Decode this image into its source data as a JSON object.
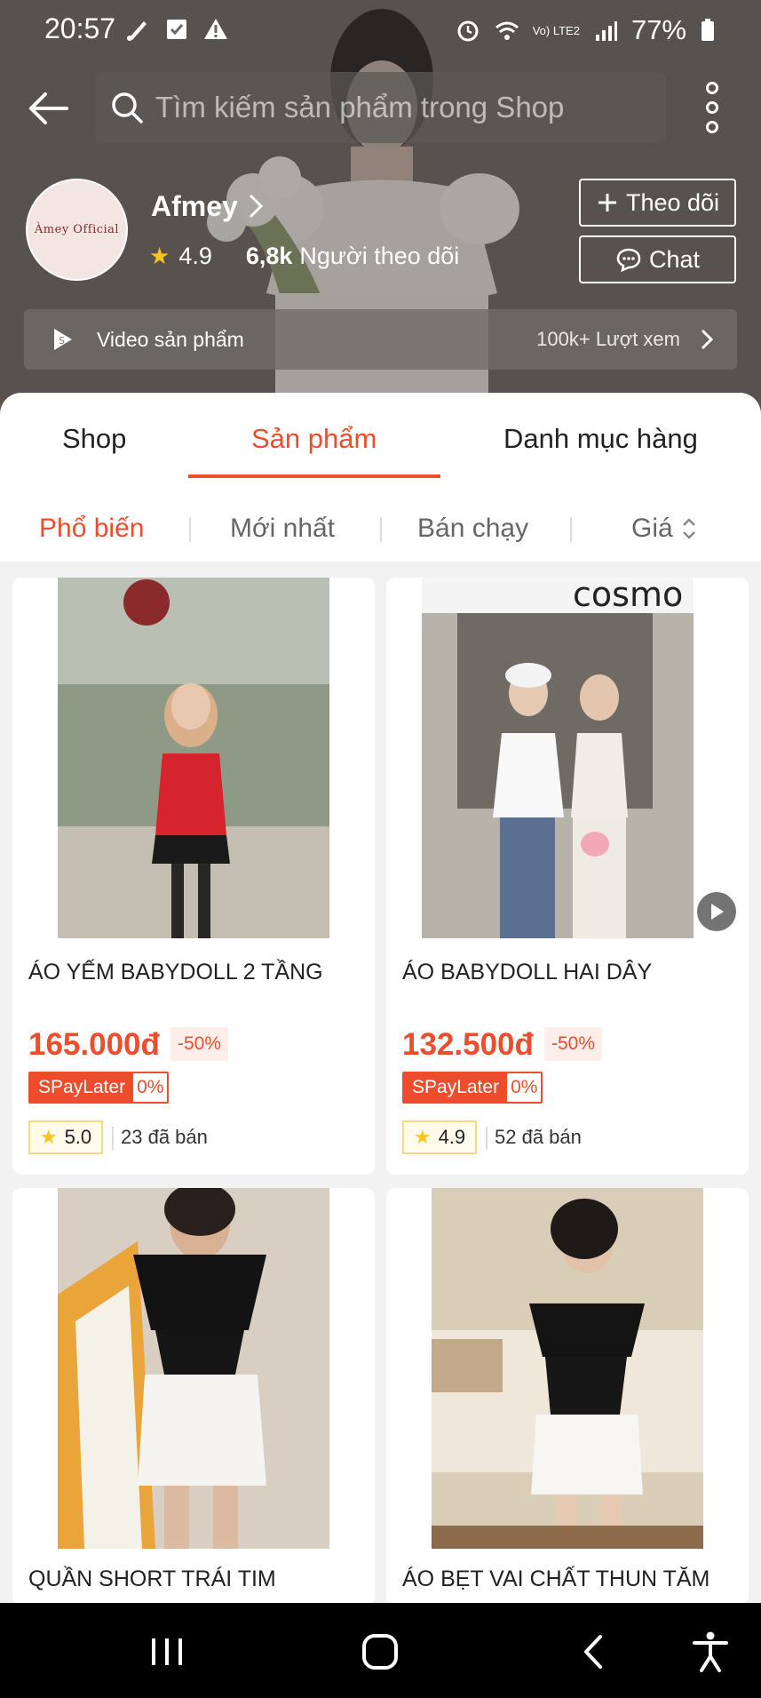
{
  "status_bar": {
    "time": "20:57",
    "battery": "77%",
    "network": "Vo) LTE2"
  },
  "header": {
    "search_placeholder": "Tìm kiếm sản phẩm trong Shop"
  },
  "shop": {
    "name": "Afmey",
    "avatar_text": "Àmey Official",
    "rating": "4.9",
    "followers_count": "6,8k",
    "followers_label": "Người theo dõi",
    "follow_label": "Theo dõi",
    "chat_label": "Chat",
    "video_label": "Video sản phẩm",
    "video_views": "100k+ Lượt xem"
  },
  "tabs": [
    {
      "label": "Shop",
      "active": false
    },
    {
      "label": "Sản phẩm",
      "active": true
    },
    {
      "label": "Danh mục hàng",
      "active": false
    }
  ],
  "sort": [
    {
      "label": "Phổ biến",
      "active": true
    },
    {
      "label": "Mới nhất",
      "active": false
    },
    {
      "label": "Bán chạy",
      "active": false
    },
    {
      "label": "Giá",
      "active": false
    }
  ],
  "products": [
    {
      "title": "ÁO YẾM BABYDOLL 2 TẦNG",
      "price": "165.000đ",
      "discount": "-50%",
      "spay_label": "SPayLater",
      "spay_rate": "0%",
      "rating": "5.0",
      "sold": "23 đã bán"
    },
    {
      "title": "ÁO BABYDOLL HAI DÂY",
      "price": "132.500đ",
      "discount": "-50%",
      "spay_label": "SPayLater",
      "spay_rate": "0%",
      "rating": "4.9",
      "sold": "52 đã bán",
      "has_video": true
    },
    {
      "title": "QUẦN SHORT TRÁI TIM"
    },
    {
      "title": "ÁO BẸT VAI CHẤT THUN TĂM"
    }
  ],
  "colors": {
    "accent": "#ee4d2d",
    "star": "#ffc21a",
    "rating_badge_bg": "#fffbea"
  },
  "icons": {
    "back": "arrow-left-icon",
    "search": "search-icon",
    "more": "more-vertical-icon",
    "follow": "plus-icon",
    "chat": "chat-bubble-icon",
    "video": "video-play-icon",
    "star": "star-icon"
  }
}
